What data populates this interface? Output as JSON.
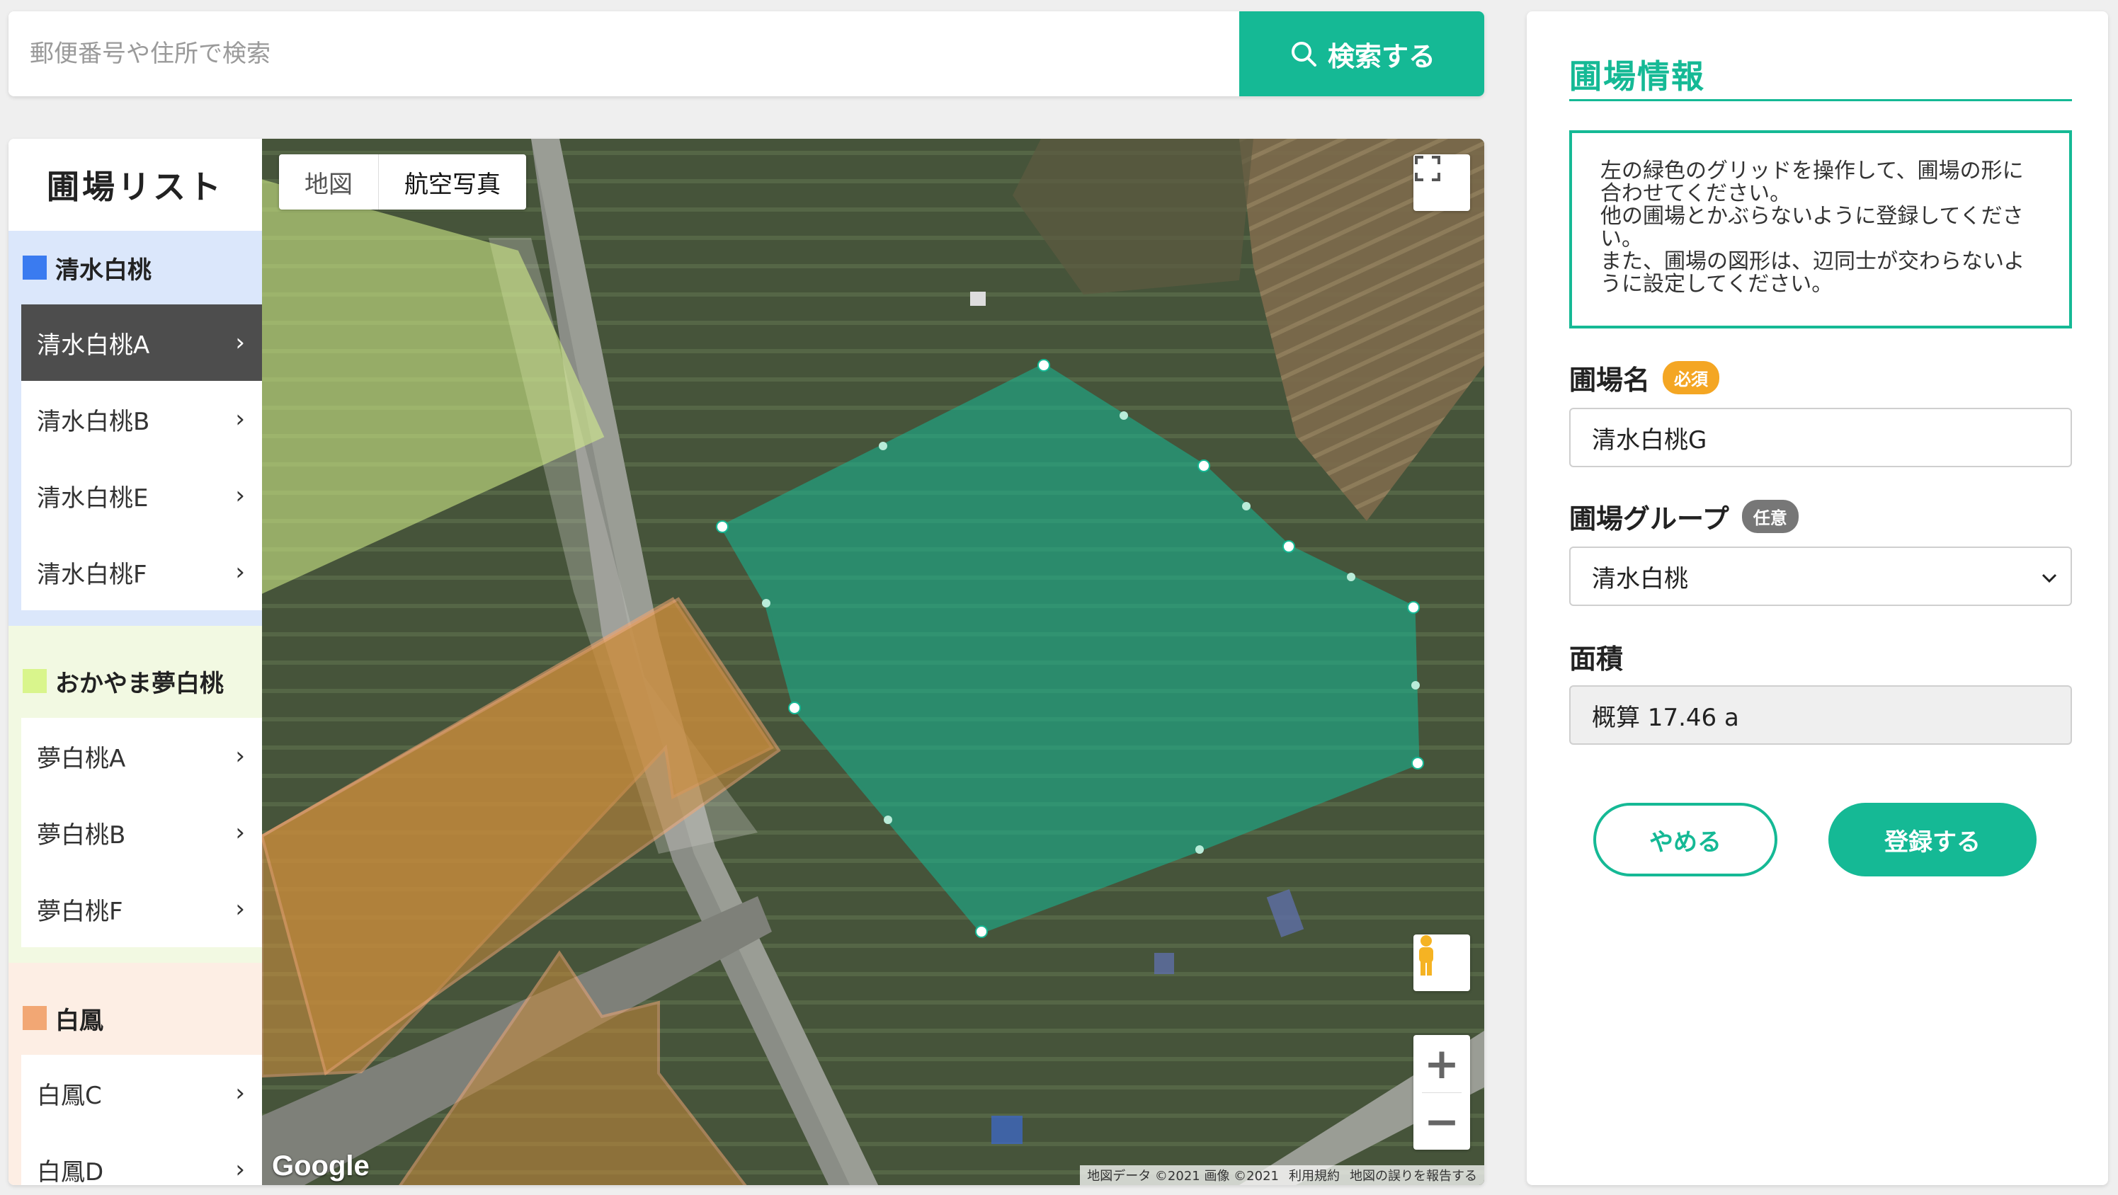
{
  "search": {
    "placeholder": "郵便番号や住所で検索",
    "button_label": "検索する"
  },
  "field_list": {
    "title": "圃場リスト",
    "groups": [
      {
        "name": "清水白桃",
        "color": "#3a7bf0",
        "bg": "#dbe7fb",
        "items": [
          "清水白桃A",
          "清水白桃B",
          "清水白桃E",
          "清水白桃F"
        ],
        "active_index": 0
      },
      {
        "name": "おかやま夢白桃",
        "color": "#d9f58c",
        "bg": "#f2f9e2",
        "items": [
          "夢白桃A",
          "夢白桃B",
          "夢白桃F"
        ]
      },
      {
        "name": "白鳳",
        "color": "#f2a774",
        "bg": "#fdeee4",
        "items": [
          "白鳳C",
          "白鳳D"
        ]
      }
    ]
  },
  "map": {
    "type_map": "地図",
    "type_satellite": "航空写真",
    "selected_type": "航空写真",
    "google_logo": "Google",
    "attribution": [
      "地図データ ©2021 画像 ©2021",
      "利用規約",
      "地図の誤りを報告する"
    ],
    "icons": [
      "fullscreen-icon",
      "pegman-icon",
      "zoom-in-icon",
      "zoom-out-icon"
    ],
    "colors": {
      "selected_polygon": "#15b995",
      "yume_polygon": "#d9f58c",
      "hakuho_polygon": "#f2a774"
    }
  },
  "panel": {
    "title": "圃場情報",
    "notice": [
      "左の緑色のグリッドを操作して、圃場の形に合わせてください。",
      "他の圃場とかぶらないように登録してください。",
      "また、圃場の図形は、辺同士が交わらないように設定してください。"
    ],
    "name_label": "圃場名",
    "name_badge": "必須",
    "name_value": "清水白桃G",
    "group_label": "圃場グループ",
    "group_badge": "任意",
    "group_value": "清水白桃",
    "area_label": "面積",
    "area_value": "概算 17.46 a",
    "cancel_label": "やめる",
    "submit_label": "登録する"
  },
  "accent_color": "#15b995"
}
